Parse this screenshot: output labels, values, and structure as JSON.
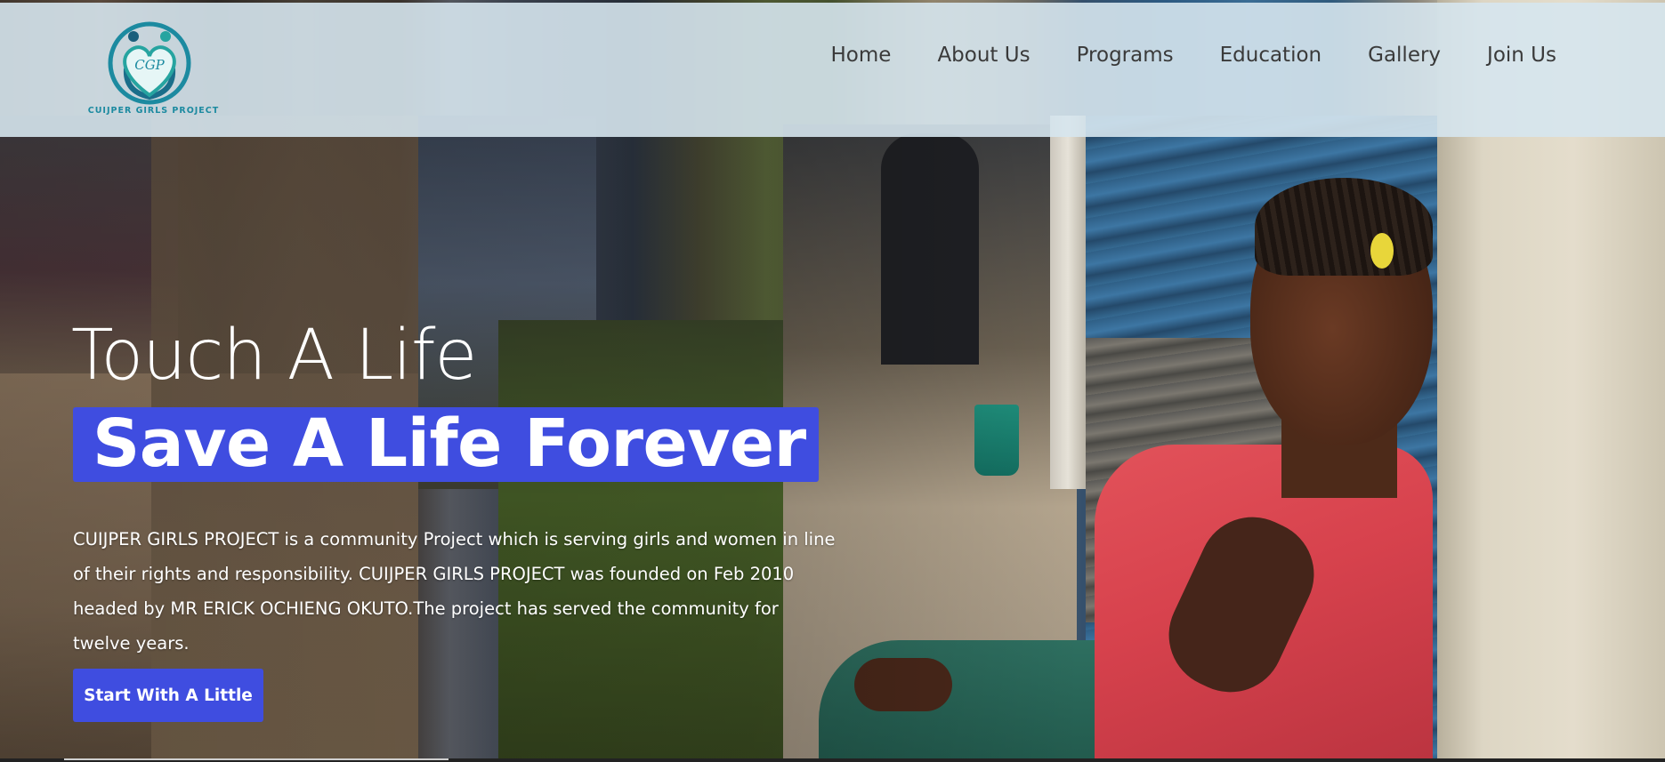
{
  "brand": {
    "logo_initials": "CGP",
    "logo_text": "CUIJPER GIRLS PROJECT",
    "logo_icon": "two-people-heart-icon",
    "accent_color": "#3f4de0",
    "logo_color": "#1c8aa0"
  },
  "nav": {
    "items": [
      {
        "label": "Home"
      },
      {
        "label": "About Us"
      },
      {
        "label": "Programs"
      },
      {
        "label": "Education"
      },
      {
        "label": "Gallery"
      },
      {
        "label": "Join Us"
      }
    ]
  },
  "hero": {
    "tagline": "Touch A Life",
    "headline": "Save A Life Forever",
    "description": "CUIJPER GIRLS PROJECT is a community Project which is serving girls and women in line of their rights and responsibility. CUIJPER GIRLS PROJECT was founded on Feb 2010 headed by MR ERICK OCHIENG OKUTO.The project has served the community for twelve years.",
    "cta_label": "Start With A Little"
  }
}
